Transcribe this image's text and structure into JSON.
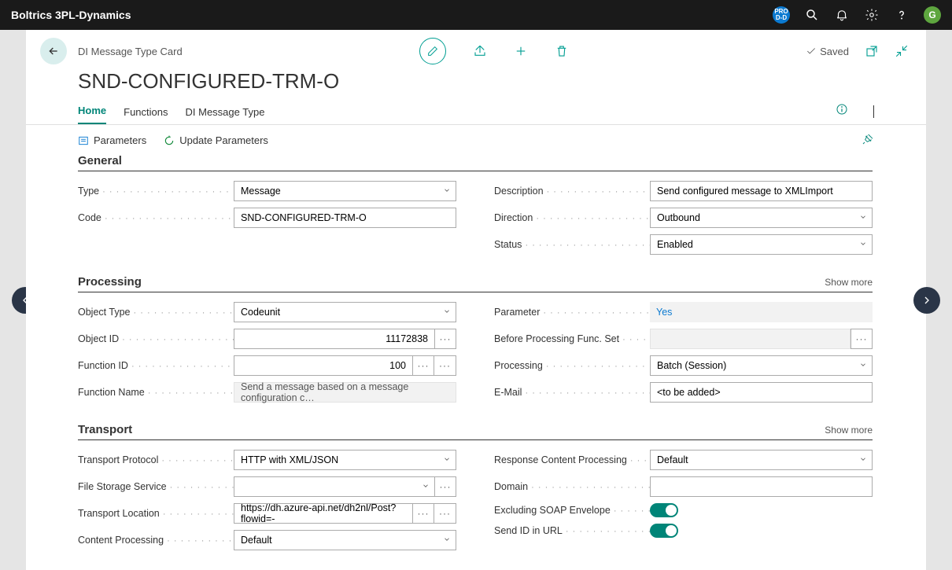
{
  "titlebar": {
    "app_name": "Boltrics 3PL-Dynamics",
    "pro_badge": "PRO D-D",
    "avatar_initial": "G"
  },
  "card": {
    "crumb": "DI Message Type Card",
    "title": "SND-CONFIGURED-TRM-O",
    "saved_label": "Saved"
  },
  "tabs": {
    "home": "Home",
    "functions": "Functions",
    "diMessageType": "DI Message Type"
  },
  "subtoolbar": {
    "parameters": "Parameters",
    "updateParameters": "Update Parameters"
  },
  "sections": {
    "general": {
      "title": "General",
      "fields": {
        "type_label": "Type",
        "type_value": "Message",
        "code_label": "Code",
        "code_value": "SND-CONFIGURED-TRM-O",
        "description_label": "Description",
        "description_value": "Send configured message to XMLImport",
        "direction_label": "Direction",
        "direction_value": "Outbound",
        "status_label": "Status",
        "status_value": "Enabled"
      }
    },
    "processing": {
      "title": "Processing",
      "show_more": "Show more",
      "fields": {
        "object_type_label": "Object Type",
        "object_type_value": "Codeunit",
        "object_id_label": "Object ID",
        "object_id_value": "11172838",
        "function_id_label": "Function ID",
        "function_id_value": "100",
        "function_name_label": "Function Name",
        "function_name_value": "Send a message based on a message configuration c…",
        "parameter_label": "Parameter",
        "parameter_value": "Yes",
        "before_proc_label": "Before Processing Func. Set",
        "before_proc_value": "",
        "processing_label": "Processing",
        "processing_value": "Batch (Session)",
        "email_label": "E-Mail",
        "email_value": "<to be added>"
      }
    },
    "transport": {
      "title": "Transport",
      "show_more": "Show more",
      "fields": {
        "protocol_label": "Transport Protocol",
        "protocol_value": "HTTP with XML/JSON",
        "file_storage_label": "File Storage Service",
        "file_storage_value": "",
        "location_label": "Transport Location",
        "location_value": "https://dh.azure-api.net/dh2nl/Post?flowid=-",
        "content_proc_label": "Content Processing",
        "content_proc_value": "Default",
        "response_proc_label": "Response Content Processing",
        "response_proc_value": "Default",
        "domain_label": "Domain",
        "domain_value": "",
        "excl_soap_label": "Excluding SOAP Envelope",
        "send_id_label": "Send ID in URL"
      }
    }
  }
}
